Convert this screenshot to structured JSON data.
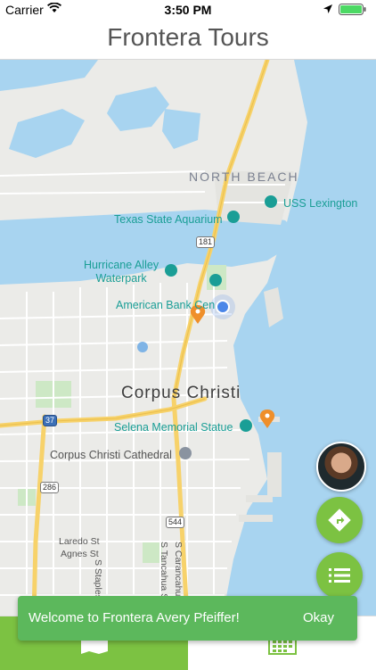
{
  "status_bar": {
    "carrier": "Carrier",
    "time": "3:50 PM"
  },
  "nav": {
    "title": "Frontera Tours"
  },
  "map": {
    "labels": {
      "north_beach": "NORTH BEACH",
      "uss_lexington": "USS Lexington",
      "texas_state_aquarium": "Texas State Aquarium",
      "hurricane_alley": "Hurricane Alley\nWaterpark",
      "american_bank": "American Bank Cen",
      "corpus_christi": "Corpus Christi",
      "selena_memorial": "Selena Memorial Statue",
      "cathedral": "Corpus Christi Cathedral",
      "laredo_st": "Laredo St",
      "agnes_st": "Agnes St",
      "s_staples_st": "S Staples St",
      "s_tancahua_st": "S Tancahua St",
      "s_carancahua": "S Carancahua"
    },
    "shields": {
      "us181": "181",
      "i37": "37",
      "r286": "286",
      "r544": "544"
    },
    "colors": {
      "water": "#a8d4f0",
      "highway": "#f7d26a",
      "poi": "#1a9e96",
      "marker": "#ef8f2a",
      "user_location": "#4a86e8"
    }
  },
  "toast": {
    "message": "Welcome to Frontera Avery Pfeiffer!",
    "action": "Okay"
  },
  "buttons": {
    "accent": "#7cc242"
  },
  "icons": {
    "avatar": "profile-avatar",
    "directions": "directions-icon",
    "list": "list-icon",
    "map_tab": "map-icon",
    "calendar_tab": "calendar-icon"
  }
}
